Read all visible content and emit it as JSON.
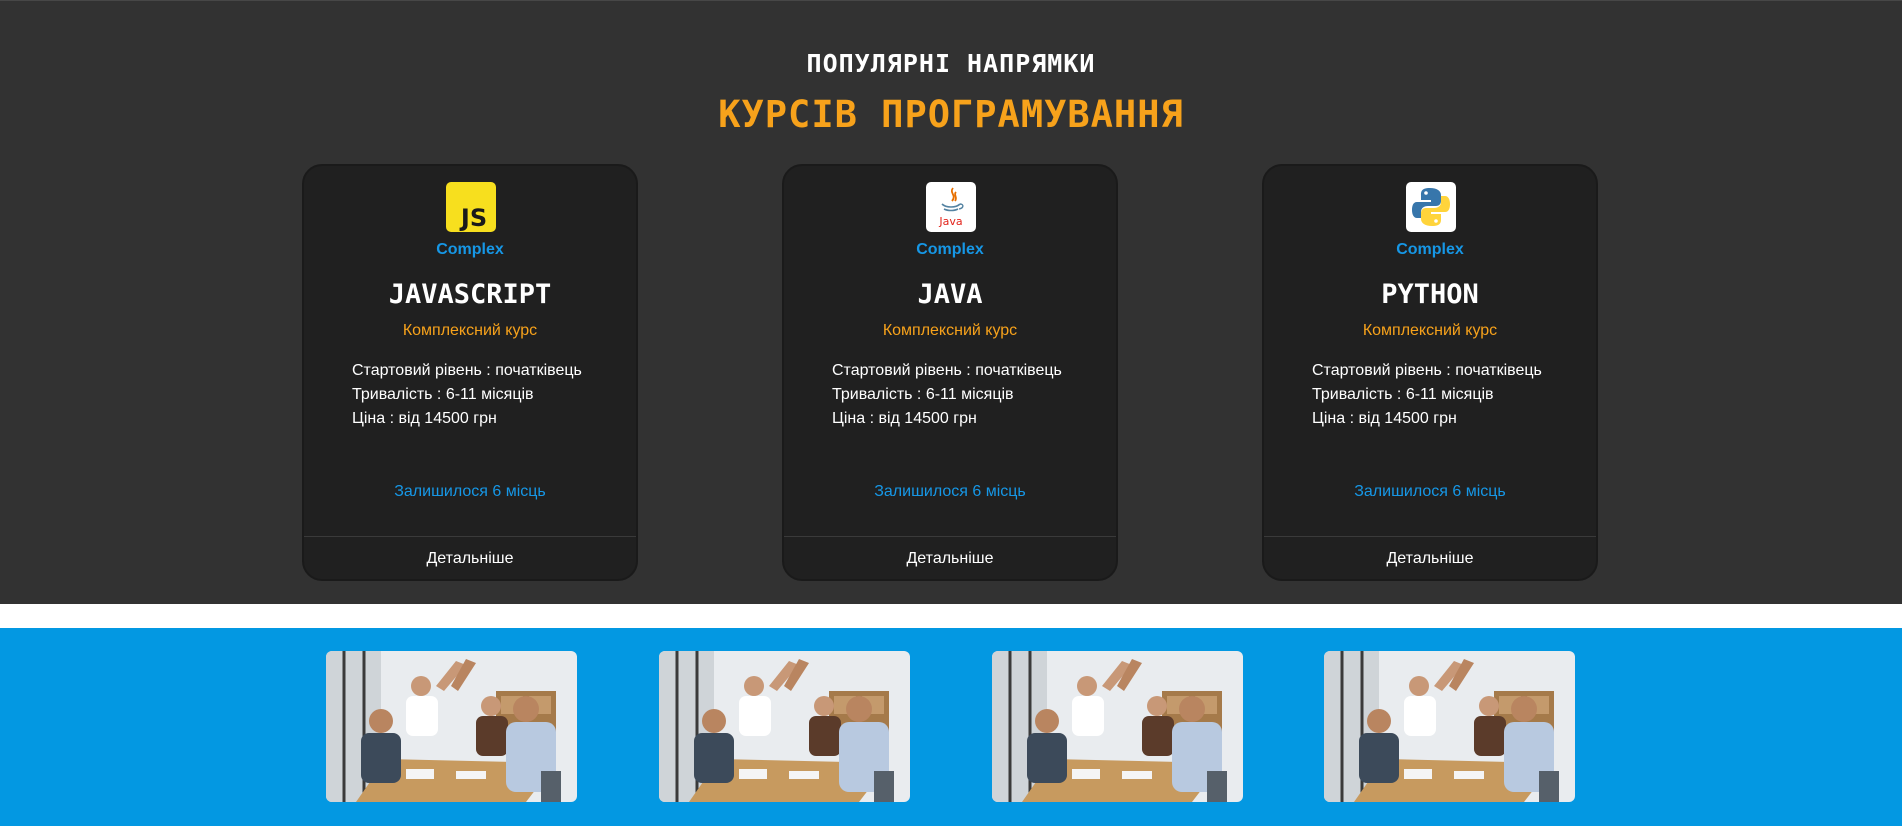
{
  "courses_section": {
    "subtitle": "ПОПУЛЯРНІ НАПРЯМКИ",
    "title": "КУРСІВ ПРОГРАМУВАННЯ"
  },
  "cards": [
    {
      "icon": "javascript-logo-icon",
      "tag": "Complex",
      "title": "JAVASCRIPT",
      "subtitle": "Комплексний курс",
      "level": "Стартовий рівень : початківець",
      "duration": "Тривалість : 6-11 місяців",
      "price": "Ціна : від 14500 грн",
      "seats": "Залишилося 6 місць",
      "more": "Детальніше"
    },
    {
      "icon": "java-logo-icon",
      "tag": "Complex",
      "title": "JAVA",
      "subtitle": "Комплексний курс",
      "level": "Стартовий рівень : початківець",
      "duration": "Тривалість : 6-11 місяців",
      "price": "Ціна : від 14500 грн",
      "seats": "Залишилося 6 місць",
      "more": "Детальніше"
    },
    {
      "icon": "python-logo-icon",
      "tag": "Complex",
      "title": "PYTHON",
      "subtitle": "Комплексний курс",
      "level": "Стартовий рівень : початківець",
      "duration": "Тривалість : 6-11 місяців",
      "price": "Ціна : від 14500 грн",
      "seats": "Залишилося 6 місць",
      "more": "Детальніше"
    }
  ],
  "logos": {
    "js_text": "JS",
    "java_text": "Java"
  },
  "gallery": {
    "photos": [
      "team-high-five-photo",
      "team-high-five-photo",
      "team-high-five-photo",
      "team-high-five-photo"
    ]
  },
  "colors": {
    "accent_orange": "#f7a21b",
    "accent_blue": "#1697e6",
    "section_bg": "#323232",
    "card_bg": "#202020",
    "gallery_bg": "#0398e2"
  }
}
